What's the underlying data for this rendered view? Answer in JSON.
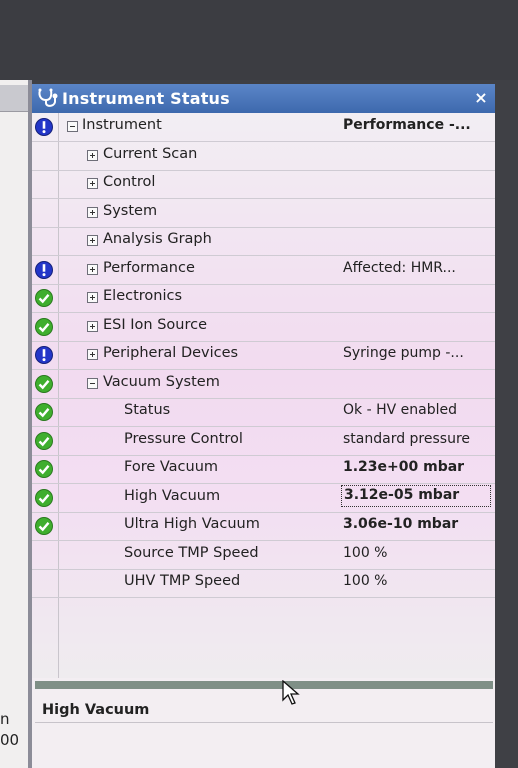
{
  "left_pane": {
    "fragment_1": "n",
    "fragment_2": "00"
  },
  "panel": {
    "title": "Instrument Status",
    "close_glyph": "×",
    "selected_item": "High Vacuum"
  },
  "colors": {
    "title_bar": "#4a77bb",
    "status_ok": "#3fae2e",
    "status_info": "#2336c8"
  },
  "tree": [
    {
      "label": "Instrument",
      "value": "Performance -...",
      "status": "info",
      "expander": "minus",
      "level": 0,
      "value_bold": true
    },
    {
      "label": "Current Scan",
      "value": "",
      "status": "none",
      "expander": "plus",
      "level": 1
    },
    {
      "label": "Control",
      "value": "",
      "status": "none",
      "expander": "plus",
      "level": 1
    },
    {
      "label": "System",
      "value": "",
      "status": "none",
      "expander": "plus",
      "level": 1
    },
    {
      "label": "Analysis Graph",
      "value": "",
      "status": "none",
      "expander": "plus",
      "level": 1
    },
    {
      "label": "Performance",
      "value": "Affected: HMR...",
      "status": "info",
      "expander": "plus",
      "level": 1
    },
    {
      "label": "Electronics",
      "value": "",
      "status": "ok",
      "expander": "plus",
      "level": 1
    },
    {
      "label": "ESI Ion Source",
      "value": "",
      "status": "ok",
      "expander": "plus",
      "level": 1
    },
    {
      "label": "Peripheral Devices",
      "value": "Syringe pump -...",
      "status": "info",
      "expander": "plus",
      "level": 1
    },
    {
      "label": "Vacuum System",
      "value": "",
      "status": "ok",
      "expander": "minus",
      "level": 1
    },
    {
      "label": "Status",
      "value": "Ok - HV enabled",
      "status": "ok",
      "expander": "none",
      "level": 2
    },
    {
      "label": "Pressure Control",
      "value": "standard pressure",
      "status": "ok",
      "expander": "none",
      "level": 2
    },
    {
      "label": "Fore Vacuum",
      "value": "1.23e+00 mbar",
      "status": "ok",
      "expander": "none",
      "level": 2,
      "value_bold": true
    },
    {
      "label": "High Vacuum",
      "value": "3.12e-05 mbar",
      "status": "ok",
      "expander": "none",
      "level": 2,
      "value_bold": true,
      "selected": true
    },
    {
      "label": "Ultra High Vacuum",
      "value": "3.06e-10 mbar",
      "status": "ok",
      "expander": "none",
      "level": 2,
      "value_bold": true
    },
    {
      "label": "Source TMP Speed",
      "value": "100 %",
      "status": "none",
      "expander": "none",
      "level": 2
    },
    {
      "label": "UHV TMP Speed",
      "value": "100 %",
      "status": "none",
      "expander": "none",
      "level": 2
    }
  ]
}
